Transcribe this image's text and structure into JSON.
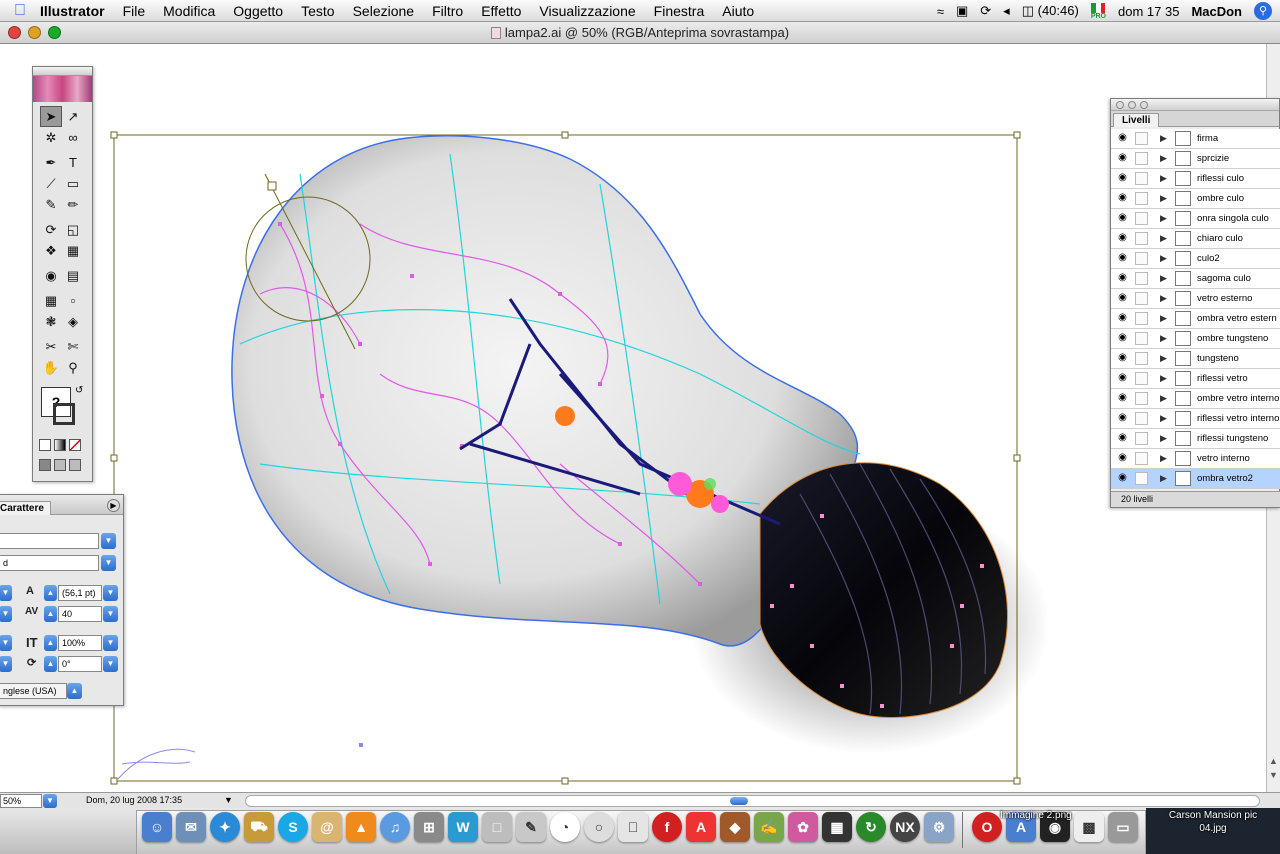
{
  "menubar": {
    "app": "Illustrator",
    "items": [
      "File",
      "Modifica",
      "Oggetto",
      "Testo",
      "Selezione",
      "Filtro",
      "Effetto",
      "Visualizzazione",
      "Finestra",
      "Aiuto"
    ],
    "battery": "(40:46)",
    "flag_label": "PRO",
    "clock": "dom 17 35",
    "user": "MacDon"
  },
  "window": {
    "title": "lampa2.ai @ 50% (RGB/Anteprima sovrastampa)"
  },
  "character_panel": {
    "tab": "Carattere",
    "leading": "(56,1 pt)",
    "tracking": "40",
    "vertical_scale": "100%",
    "rotation": "0°",
    "language": "nglese (USA)"
  },
  "layers_panel": {
    "tab": "Livelli",
    "layers": [
      {
        "name": "firma"
      },
      {
        "name": "sprcizie"
      },
      {
        "name": "riflessi culo"
      },
      {
        "name": "ombre culo"
      },
      {
        "name": "onra singola culo"
      },
      {
        "name": "chiaro culo"
      },
      {
        "name": "culo2"
      },
      {
        "name": "sagoma culo"
      },
      {
        "name": "vetro esterno"
      },
      {
        "name": "ombra vetro estern"
      },
      {
        "name": "ombre tungsteno"
      },
      {
        "name": "tungsteno"
      },
      {
        "name": "riflessi vetro"
      },
      {
        "name": "ombre vetro interno"
      },
      {
        "name": "riflessi vetro interno"
      },
      {
        "name": "riflessi tungsteno"
      },
      {
        "name": "vetro interno"
      },
      {
        "name": "ombra vetro2"
      }
    ],
    "selected_layer": "ombra vetro2",
    "count": "20 livelli"
  },
  "status_bar": {
    "zoom": "50%",
    "info": "Dom, 20 lug 2008  17:35"
  },
  "dock": {
    "hover_label": "Immagine 2.png",
    "desktop_file_line1": "Carson Mansion pic",
    "desktop_file_line2": "04.jpg"
  }
}
